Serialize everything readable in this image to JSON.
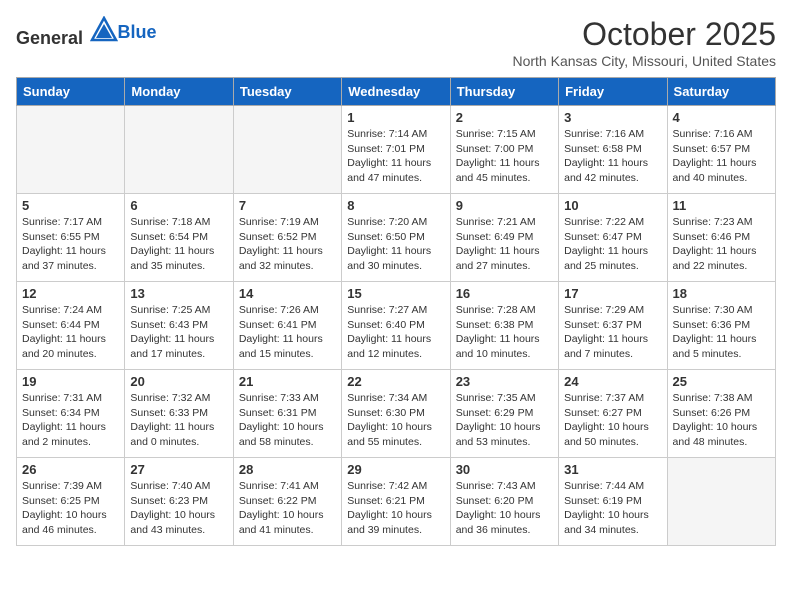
{
  "header": {
    "logo_general": "General",
    "logo_blue": "Blue",
    "title": "October 2025",
    "subtitle": "North Kansas City, Missouri, United States"
  },
  "days_of_week": [
    "Sunday",
    "Monday",
    "Tuesday",
    "Wednesday",
    "Thursday",
    "Friday",
    "Saturday"
  ],
  "weeks": [
    [
      {
        "day": "",
        "empty": true,
        "text": ""
      },
      {
        "day": "",
        "empty": true,
        "text": ""
      },
      {
        "day": "",
        "empty": true,
        "text": ""
      },
      {
        "day": "1",
        "empty": false,
        "text": "Sunrise: 7:14 AM\nSunset: 7:01 PM\nDaylight: 11 hours\nand 47 minutes."
      },
      {
        "day": "2",
        "empty": false,
        "text": "Sunrise: 7:15 AM\nSunset: 7:00 PM\nDaylight: 11 hours\nand 45 minutes."
      },
      {
        "day": "3",
        "empty": false,
        "text": "Sunrise: 7:16 AM\nSunset: 6:58 PM\nDaylight: 11 hours\nand 42 minutes."
      },
      {
        "day": "4",
        "empty": false,
        "text": "Sunrise: 7:16 AM\nSunset: 6:57 PM\nDaylight: 11 hours\nand 40 minutes."
      }
    ],
    [
      {
        "day": "5",
        "empty": false,
        "text": "Sunrise: 7:17 AM\nSunset: 6:55 PM\nDaylight: 11 hours\nand 37 minutes."
      },
      {
        "day": "6",
        "empty": false,
        "text": "Sunrise: 7:18 AM\nSunset: 6:54 PM\nDaylight: 11 hours\nand 35 minutes."
      },
      {
        "day": "7",
        "empty": false,
        "text": "Sunrise: 7:19 AM\nSunset: 6:52 PM\nDaylight: 11 hours\nand 32 minutes."
      },
      {
        "day": "8",
        "empty": false,
        "text": "Sunrise: 7:20 AM\nSunset: 6:50 PM\nDaylight: 11 hours\nand 30 minutes."
      },
      {
        "day": "9",
        "empty": false,
        "text": "Sunrise: 7:21 AM\nSunset: 6:49 PM\nDaylight: 11 hours\nand 27 minutes."
      },
      {
        "day": "10",
        "empty": false,
        "text": "Sunrise: 7:22 AM\nSunset: 6:47 PM\nDaylight: 11 hours\nand 25 minutes."
      },
      {
        "day": "11",
        "empty": false,
        "text": "Sunrise: 7:23 AM\nSunset: 6:46 PM\nDaylight: 11 hours\nand 22 minutes."
      }
    ],
    [
      {
        "day": "12",
        "empty": false,
        "text": "Sunrise: 7:24 AM\nSunset: 6:44 PM\nDaylight: 11 hours\nand 20 minutes."
      },
      {
        "day": "13",
        "empty": false,
        "text": "Sunrise: 7:25 AM\nSunset: 6:43 PM\nDaylight: 11 hours\nand 17 minutes."
      },
      {
        "day": "14",
        "empty": false,
        "text": "Sunrise: 7:26 AM\nSunset: 6:41 PM\nDaylight: 11 hours\nand 15 minutes."
      },
      {
        "day": "15",
        "empty": false,
        "text": "Sunrise: 7:27 AM\nSunset: 6:40 PM\nDaylight: 11 hours\nand 12 minutes."
      },
      {
        "day": "16",
        "empty": false,
        "text": "Sunrise: 7:28 AM\nSunset: 6:38 PM\nDaylight: 11 hours\nand 10 minutes."
      },
      {
        "day": "17",
        "empty": false,
        "text": "Sunrise: 7:29 AM\nSunset: 6:37 PM\nDaylight: 11 hours\nand 7 minutes."
      },
      {
        "day": "18",
        "empty": false,
        "text": "Sunrise: 7:30 AM\nSunset: 6:36 PM\nDaylight: 11 hours\nand 5 minutes."
      }
    ],
    [
      {
        "day": "19",
        "empty": false,
        "text": "Sunrise: 7:31 AM\nSunset: 6:34 PM\nDaylight: 11 hours\nand 2 minutes."
      },
      {
        "day": "20",
        "empty": false,
        "text": "Sunrise: 7:32 AM\nSunset: 6:33 PM\nDaylight: 11 hours\nand 0 minutes."
      },
      {
        "day": "21",
        "empty": false,
        "text": "Sunrise: 7:33 AM\nSunset: 6:31 PM\nDaylight: 10 hours\nand 58 minutes."
      },
      {
        "day": "22",
        "empty": false,
        "text": "Sunrise: 7:34 AM\nSunset: 6:30 PM\nDaylight: 10 hours\nand 55 minutes."
      },
      {
        "day": "23",
        "empty": false,
        "text": "Sunrise: 7:35 AM\nSunset: 6:29 PM\nDaylight: 10 hours\nand 53 minutes."
      },
      {
        "day": "24",
        "empty": false,
        "text": "Sunrise: 7:37 AM\nSunset: 6:27 PM\nDaylight: 10 hours\nand 50 minutes."
      },
      {
        "day": "25",
        "empty": false,
        "text": "Sunrise: 7:38 AM\nSunset: 6:26 PM\nDaylight: 10 hours\nand 48 minutes."
      }
    ],
    [
      {
        "day": "26",
        "empty": false,
        "text": "Sunrise: 7:39 AM\nSunset: 6:25 PM\nDaylight: 10 hours\nand 46 minutes."
      },
      {
        "day": "27",
        "empty": false,
        "text": "Sunrise: 7:40 AM\nSunset: 6:23 PM\nDaylight: 10 hours\nand 43 minutes."
      },
      {
        "day": "28",
        "empty": false,
        "text": "Sunrise: 7:41 AM\nSunset: 6:22 PM\nDaylight: 10 hours\nand 41 minutes."
      },
      {
        "day": "29",
        "empty": false,
        "text": "Sunrise: 7:42 AM\nSunset: 6:21 PM\nDaylight: 10 hours\nand 39 minutes."
      },
      {
        "day": "30",
        "empty": false,
        "text": "Sunrise: 7:43 AM\nSunset: 6:20 PM\nDaylight: 10 hours\nand 36 minutes."
      },
      {
        "day": "31",
        "empty": false,
        "text": "Sunrise: 7:44 AM\nSunset: 6:19 PM\nDaylight: 10 hours\nand 34 minutes."
      },
      {
        "day": "",
        "empty": true,
        "text": ""
      }
    ]
  ]
}
